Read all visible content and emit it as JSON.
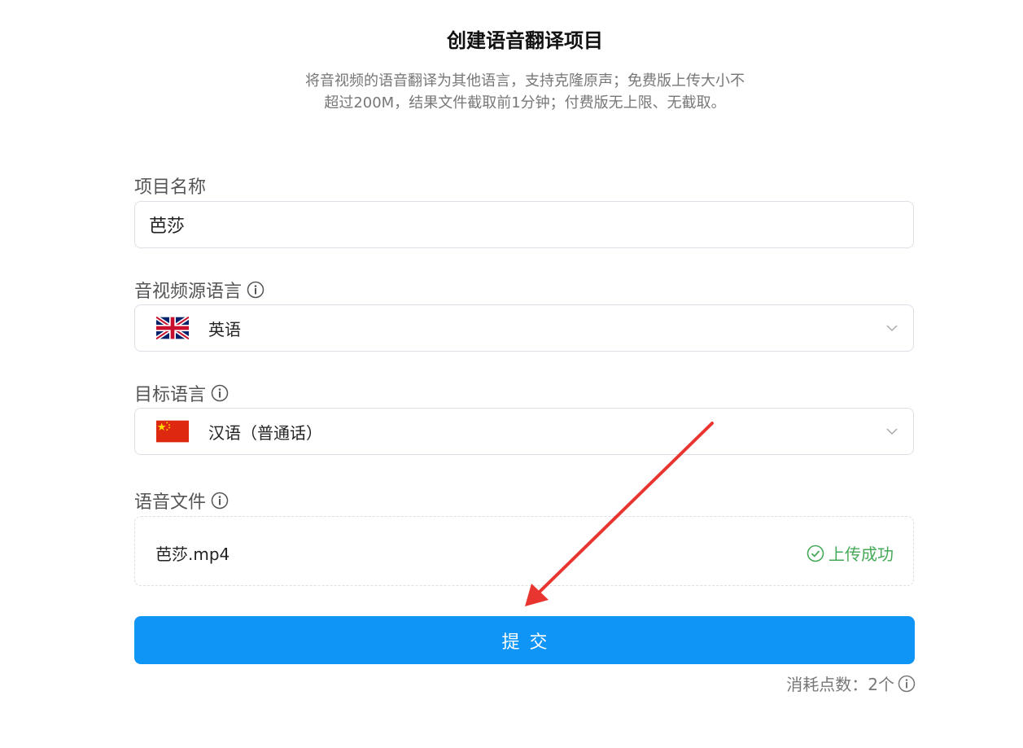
{
  "page": {
    "title": "创建语音翻译项目",
    "subtitle_line1": "将音视频的语音翻译为其他语言，支持克隆原声；免费版上传大小不",
    "subtitle_line2": "超过200M，结果文件截取前1分钟；付费版无上限、无截取。"
  },
  "form": {
    "project_name": {
      "label": "项目名称",
      "value": "芭莎"
    },
    "source_language": {
      "label": "音视频源语言",
      "value": "英语",
      "flag_icon": "uk-flag-icon"
    },
    "target_language": {
      "label": "目标语言",
      "value": "汉语（普通话）",
      "flag_icon": "china-flag-icon"
    },
    "voice_file": {
      "label": "语音文件",
      "file_name": "芭莎.mp4",
      "status": "上传成功"
    },
    "submit_label": "提交",
    "cost_text": "消耗点数：2个"
  },
  "colors": {
    "primary": "#0f95f5",
    "success": "#45a957",
    "annotation_arrow": "#e8352f"
  }
}
